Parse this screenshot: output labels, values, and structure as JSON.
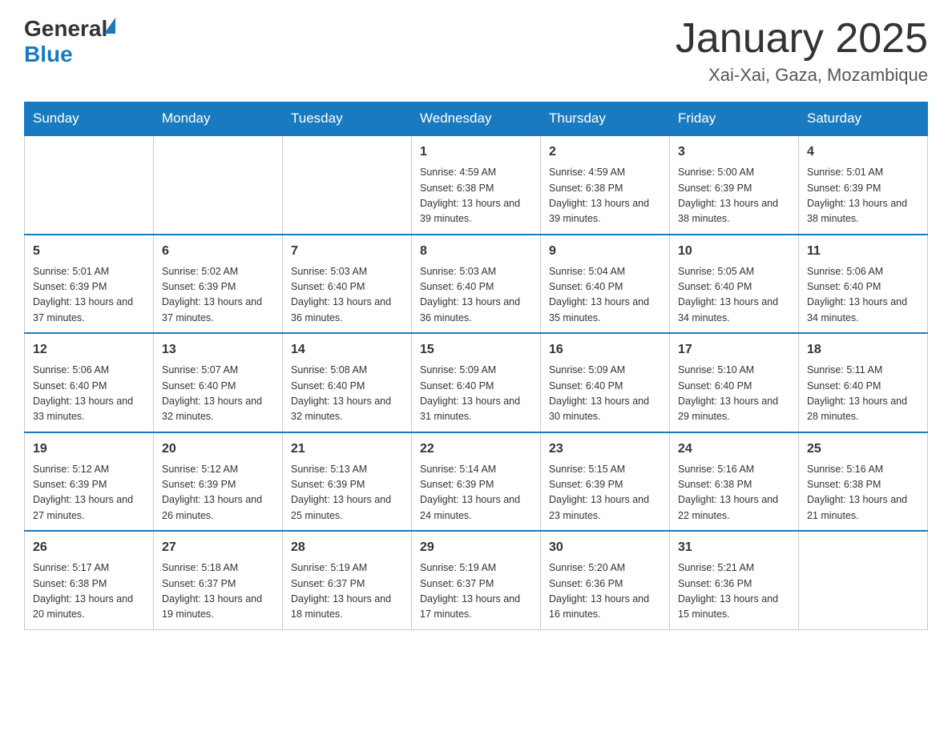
{
  "header": {
    "logo_general": "General",
    "logo_blue": "Blue",
    "month_title": "January 2025",
    "subtitle": "Xai-Xai, Gaza, Mozambique"
  },
  "weekdays": [
    "Sunday",
    "Monday",
    "Tuesday",
    "Wednesday",
    "Thursday",
    "Friday",
    "Saturday"
  ],
  "weeks": [
    [
      {
        "day": "",
        "info": ""
      },
      {
        "day": "",
        "info": ""
      },
      {
        "day": "",
        "info": ""
      },
      {
        "day": "1",
        "info": "Sunrise: 4:59 AM\nSunset: 6:38 PM\nDaylight: 13 hours\nand 39 minutes."
      },
      {
        "day": "2",
        "info": "Sunrise: 4:59 AM\nSunset: 6:38 PM\nDaylight: 13 hours\nand 39 minutes."
      },
      {
        "day": "3",
        "info": "Sunrise: 5:00 AM\nSunset: 6:39 PM\nDaylight: 13 hours\nand 38 minutes."
      },
      {
        "day": "4",
        "info": "Sunrise: 5:01 AM\nSunset: 6:39 PM\nDaylight: 13 hours\nand 38 minutes."
      }
    ],
    [
      {
        "day": "5",
        "info": "Sunrise: 5:01 AM\nSunset: 6:39 PM\nDaylight: 13 hours\nand 37 minutes."
      },
      {
        "day": "6",
        "info": "Sunrise: 5:02 AM\nSunset: 6:39 PM\nDaylight: 13 hours\nand 37 minutes."
      },
      {
        "day": "7",
        "info": "Sunrise: 5:03 AM\nSunset: 6:40 PM\nDaylight: 13 hours\nand 36 minutes."
      },
      {
        "day": "8",
        "info": "Sunrise: 5:03 AM\nSunset: 6:40 PM\nDaylight: 13 hours\nand 36 minutes."
      },
      {
        "day": "9",
        "info": "Sunrise: 5:04 AM\nSunset: 6:40 PM\nDaylight: 13 hours\nand 35 minutes."
      },
      {
        "day": "10",
        "info": "Sunrise: 5:05 AM\nSunset: 6:40 PM\nDaylight: 13 hours\nand 34 minutes."
      },
      {
        "day": "11",
        "info": "Sunrise: 5:06 AM\nSunset: 6:40 PM\nDaylight: 13 hours\nand 34 minutes."
      }
    ],
    [
      {
        "day": "12",
        "info": "Sunrise: 5:06 AM\nSunset: 6:40 PM\nDaylight: 13 hours\nand 33 minutes."
      },
      {
        "day": "13",
        "info": "Sunrise: 5:07 AM\nSunset: 6:40 PM\nDaylight: 13 hours\nand 32 minutes."
      },
      {
        "day": "14",
        "info": "Sunrise: 5:08 AM\nSunset: 6:40 PM\nDaylight: 13 hours\nand 32 minutes."
      },
      {
        "day": "15",
        "info": "Sunrise: 5:09 AM\nSunset: 6:40 PM\nDaylight: 13 hours\nand 31 minutes."
      },
      {
        "day": "16",
        "info": "Sunrise: 5:09 AM\nSunset: 6:40 PM\nDaylight: 13 hours\nand 30 minutes."
      },
      {
        "day": "17",
        "info": "Sunrise: 5:10 AM\nSunset: 6:40 PM\nDaylight: 13 hours\nand 29 minutes."
      },
      {
        "day": "18",
        "info": "Sunrise: 5:11 AM\nSunset: 6:40 PM\nDaylight: 13 hours\nand 28 minutes."
      }
    ],
    [
      {
        "day": "19",
        "info": "Sunrise: 5:12 AM\nSunset: 6:39 PM\nDaylight: 13 hours\nand 27 minutes."
      },
      {
        "day": "20",
        "info": "Sunrise: 5:12 AM\nSunset: 6:39 PM\nDaylight: 13 hours\nand 26 minutes."
      },
      {
        "day": "21",
        "info": "Sunrise: 5:13 AM\nSunset: 6:39 PM\nDaylight: 13 hours\nand 25 minutes."
      },
      {
        "day": "22",
        "info": "Sunrise: 5:14 AM\nSunset: 6:39 PM\nDaylight: 13 hours\nand 24 minutes."
      },
      {
        "day": "23",
        "info": "Sunrise: 5:15 AM\nSunset: 6:39 PM\nDaylight: 13 hours\nand 23 minutes."
      },
      {
        "day": "24",
        "info": "Sunrise: 5:16 AM\nSunset: 6:38 PM\nDaylight: 13 hours\nand 22 minutes."
      },
      {
        "day": "25",
        "info": "Sunrise: 5:16 AM\nSunset: 6:38 PM\nDaylight: 13 hours\nand 21 minutes."
      }
    ],
    [
      {
        "day": "26",
        "info": "Sunrise: 5:17 AM\nSunset: 6:38 PM\nDaylight: 13 hours\nand 20 minutes."
      },
      {
        "day": "27",
        "info": "Sunrise: 5:18 AM\nSunset: 6:37 PM\nDaylight: 13 hours\nand 19 minutes."
      },
      {
        "day": "28",
        "info": "Sunrise: 5:19 AM\nSunset: 6:37 PM\nDaylight: 13 hours\nand 18 minutes."
      },
      {
        "day": "29",
        "info": "Sunrise: 5:19 AM\nSunset: 6:37 PM\nDaylight: 13 hours\nand 17 minutes."
      },
      {
        "day": "30",
        "info": "Sunrise: 5:20 AM\nSunset: 6:36 PM\nDaylight: 13 hours\nand 16 minutes."
      },
      {
        "day": "31",
        "info": "Sunrise: 5:21 AM\nSunset: 6:36 PM\nDaylight: 13 hours\nand 15 minutes."
      },
      {
        "day": "",
        "info": ""
      }
    ]
  ]
}
